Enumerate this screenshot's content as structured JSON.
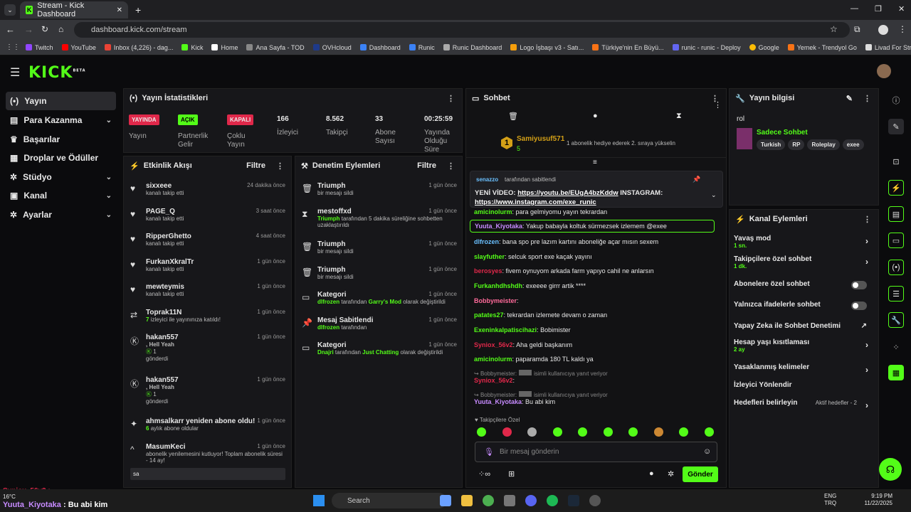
{
  "browser": {
    "tab_title": "Stream - Kick Dashboard",
    "url": "dashboard.kick.com/stream",
    "bookmarks": [
      "Twitch",
      "YouTube",
      "Inbox (4,226) - dag...",
      "Kick",
      "Home",
      "Ana Sayfa - TOD",
      "OVHcloud",
      "Dashboard",
      "Runic",
      "Runic Dashboard",
      "Logo İşbaşı v3 - Satı...",
      "Türkiye'nin En Büyü...",
      "runic - runic - Deploy",
      "Google",
      "Yemek - Trendyol Go",
      "Livad For Streamers"
    ]
  },
  "brand": {
    "logo": "KICK",
    "beta": "BETA",
    "accent": "#53fc18"
  },
  "nav": [
    {
      "label": "Yayın",
      "icon": "broadcast-icon"
    },
    {
      "label": "Para Kazanma",
      "icon": "money-icon"
    },
    {
      "label": "Başarılar",
      "icon": "trophy-icon"
    },
    {
      "label": "Droplar ve Ödüller",
      "icon": "gift-icon"
    },
    {
      "label": "Stüdyo",
      "icon": "gear-icon"
    },
    {
      "label": "Kanal",
      "icon": "user-icon"
    },
    {
      "label": "Ayarlar",
      "icon": "gear-icon"
    }
  ],
  "stats": {
    "title": "Yayın İstatistikleri",
    "tiles": [
      {
        "tag": "YAYINDA",
        "label": "Yayın"
      },
      {
        "tag": "AÇIK",
        "label": "Partnerlik Gelir"
      },
      {
        "tag": "KAPALI",
        "label": "Çoklu Yayın"
      },
      {
        "value": "166",
        "label": "İzleyici"
      },
      {
        "value": "8.562",
        "label": "Takipçi"
      },
      {
        "value": "33",
        "label": "Abone Sayısı"
      },
      {
        "value": "00:25:59",
        "label": "Yayında Olduğu Süre"
      }
    ]
  },
  "activity": {
    "title": "Etkinlik Akışı",
    "filter": "Filtre",
    "items": [
      {
        "title": "sixxeee",
        "sub": "kanalı takip etti",
        "time": "24 dakika önce"
      },
      {
        "title": "PAGE_Q",
        "sub": "kanalı takip etti",
        "time": "3 saat önce"
      },
      {
        "title": "RipperGhetto",
        "sub": "kanalı takip etti",
        "time": "4 saat önce"
      },
      {
        "title": "FurkanXkralTr",
        "sub": "kanalı takip etti",
        "time": "1 gün önce"
      },
      {
        "title": "mewteymis",
        "sub": "kanalı takip etti",
        "time": "1 gün önce"
      },
      {
        "title": "Toprak11N",
        "sub_a": "7",
        "sub": "izleyici ile yayınınıza katıldı!",
        "time": "1 gün önce"
      },
      {
        "title": "hakan557",
        "sub_g": ", Hell Yeah",
        "sub_k": "1",
        "sub": "gönderdi",
        "time": "1 gün önce"
      },
      {
        "title": "hakan557",
        "sub_g": ", Hell Yeah",
        "sub_k": "1",
        "sub": "gönderdi",
        "time": "1 gün önce"
      },
      {
        "title": "ahmsalkarr yeniden abone oldu!",
        "sub_a": "6",
        "sub": "aylık abone oldular",
        "time": "1 gün önce"
      },
      {
        "title": "MasumKeci",
        "sub": "abonelik yenilemesini kutluyor! Toplam abonelik süresi - 14 ay!",
        "time": "1 gün önce",
        "msg": "sa"
      }
    ]
  },
  "moderation": {
    "title": "Denetim Eylemleri",
    "filter": "Filtre",
    "items": [
      {
        "title": "Triumph",
        "sub": "bir mesajı sildi",
        "time": "1 gün önce"
      },
      {
        "title": "mestoffxd",
        "sub_g": "Triumph",
        "sub": "tarafından 5 dakika süreliğine sohbetten uzaklaştırıldı",
        "time": "1 gün önce"
      },
      {
        "title": "Triumph",
        "sub": "bir mesajı sildi",
        "time": "1 gün önce"
      },
      {
        "title": "Triumph",
        "sub": "bir mesajı sildi",
        "time": "1 gün önce"
      },
      {
        "title": "Kategori",
        "sub_g": "dlfrozen",
        "sub": "tarafından",
        "sub_g2": "Garry's Mod",
        "sub2": "olarak değiştirildi",
        "time": "1 gün önce"
      },
      {
        "title": "Mesaj Sabitlendi",
        "sub_g": "dlfrozen",
        "sub": "tarafından",
        "time": "1 gün önce"
      },
      {
        "title": "Kategori",
        "sub_g": "Dnajri",
        "sub": "tarafından",
        "sub_g2": "Just Chatting",
        "sub2": "olarak değiştirildi",
        "time": "1 gün önce"
      }
    ]
  },
  "chat": {
    "title": "Sohbet",
    "sub_gift": {
      "user": "Samiyusuf571",
      "count": "5",
      "text": "1 abonelik hediye ederek 2. sıraya yükselin",
      "rank": "1"
    },
    "pinned": {
      "by": "senazzo",
      "by_text": "tarafından sabitlendi",
      "text": "YENİ VİDEO:",
      "link1": "https://youtu.be/EUgA4bzKddw",
      "mid": "INSTAGRAM:",
      "link2": "https://www.instagram.com/exe_runic"
    },
    "messages": [
      {
        "user": "amicinolurm",
        "color": "#53fc18",
        "text": "para gelmiyomu yayın tekrardan"
      },
      {
        "user": "Yuuta_Kiyotaka",
        "color": "#c78bff",
        "text": "Yakup babayla koltuk sürmezsek izlemem @exee"
      },
      {
        "user": "dlfrozen",
        "color": "#6ac0ff",
        "text": "bana spo pre lazım kartını aboneliğe açar mısın sexem"
      },
      {
        "user": "slayfuther",
        "color": "#53fc18",
        "text": "selcuk sport exe kaçak yayını"
      },
      {
        "user": "berosyes",
        "color": "#e0284a",
        "text": "fivem oynuyom arkada farm yapıyo cahil ne anlarsın"
      },
      {
        "user": "Furkanhdhshdh",
        "color": "#53fc18",
        "text": "exeeee girrr artik ****"
      },
      {
        "user": "Bobbymeister",
        "color": "#ff6a9a",
        "text": ""
      },
      {
        "user": "patates27",
        "color": "#53fc18",
        "text": "tekrardan izlemete devam o zaman"
      },
      {
        "user": "Exeninkalpatiscihazi",
        "color": "#53fc18",
        "text": "Bobimister"
      },
      {
        "user": "Syniox_56v2",
        "color": "#e0284a",
        "text": "Aha geldi başkanım"
      },
      {
        "user": "amicinolurm",
        "color": "#53fc18",
        "text": "paparamda 180 TL kaldı ya"
      },
      {
        "reply_to": "Bobbymeister:",
        "reply_text": "isimli kullanıcıya yanıt veriyor",
        "user": "Syniox_56v2",
        "color": "#e0284a",
        "text": ""
      },
      {
        "reply_to": "Bobbymeister:",
        "reply_text": "isimli kullanıcıya yanıt veriyor",
        "user": "Yuuta_Kiyotaka",
        "color": "#c78bff",
        "text": "Bu abi kim"
      }
    ],
    "followers_only": "Takipçilere Özel",
    "placeholder": "Bir mesaj gönderin",
    "send": "Gönder"
  },
  "info": {
    "title": "Yayın bilgisi",
    "title_value": "rol",
    "category": "Sadece Sohbet",
    "tags": [
      "Turkish",
      "RP",
      "Roleplay",
      "exee"
    ]
  },
  "actions": {
    "title": "Kanal Eylemleri",
    "rows": [
      {
        "label": "Yavaş mod",
        "sub": "1 sn."
      },
      {
        "label": "Takipçilere özel sohbet",
        "sub": "1 dk."
      },
      {
        "label": "Abonelere özel sohbet"
      },
      {
        "label": "Yalnızca ifadelerle sohbet"
      },
      {
        "label": "Yapay Zeka ile Sohbet Denetimi"
      },
      {
        "label": "Hesap yaşı kısıtlaması",
        "sub": "2 ay"
      },
      {
        "label": "Yasaklanmış kelimeler"
      },
      {
        "label": "İzleyici Yönlendir"
      },
      {
        "label": "Hedefleri belirleyin",
        "status": "Aktif hedefler - 2"
      }
    ]
  },
  "overlay": {
    "line1_user": "Syniox_56v2",
    "line2_user": "Yuuta_Kiyotaka",
    "line2_text": "Bu abi kim"
  },
  "taskbar": {
    "weather": "16°C",
    "search": "Search",
    "lang": "ENG",
    "lang2": "TRQ",
    "time": "9:19 PM",
    "date": "11/22/2025"
  }
}
